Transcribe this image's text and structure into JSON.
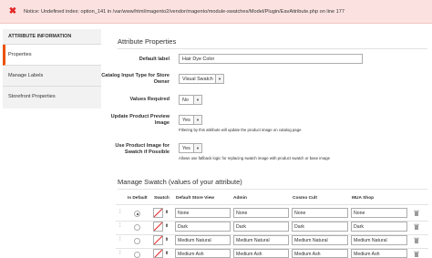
{
  "notice": {
    "text": "Notice: Undefined index: option_141 in /var/www/html/magento2/vendor/magento/module-swatches/Model/Plugin/EavAttribute.php on line 177"
  },
  "sidebar": {
    "title": "ATTRIBUTE INFORMATION",
    "items": [
      {
        "label": "Properties"
      },
      {
        "label": "Manage Labels"
      },
      {
        "label": "Storefront Properties"
      }
    ]
  },
  "properties": {
    "title": "Attribute Properties",
    "default_label": {
      "label": "Default label",
      "value": "Hair Dye Color"
    },
    "catalog_input": {
      "label": "Catalog Input Type for Store Owner",
      "value": "Visual Swatch"
    },
    "values_required": {
      "label": "Values Required",
      "value": "No"
    },
    "update_preview": {
      "label": "Update Product Preview Image",
      "value": "Yes",
      "note": "Filtering by this attribute will update the product image on catalog page"
    },
    "use_fallback": {
      "label": "Use Product Image for Swatch if Possible",
      "value": "Yes",
      "note": "Allows use fallback logic for replacing swatch image with product swatch or base image"
    }
  },
  "swatch": {
    "title": "Manage Swatch (values of your attribute)",
    "columns": [
      "Is Default",
      "Swatch",
      "Default Store View",
      "Admin",
      "Cosmo Cult",
      "MUA Shop"
    ],
    "rows": [
      {
        "is_default": true,
        "values": [
          "None",
          "None",
          "None",
          "None"
        ]
      },
      {
        "is_default": false,
        "values": [
          "Dark",
          "Dark",
          "Dark",
          "Dark"
        ]
      },
      {
        "is_default": false,
        "values": [
          "Medium Natural",
          "Medium Natural",
          "Medium Natural",
          "Medium Natural"
        ]
      },
      {
        "is_default": false,
        "values": [
          "Medium Ash",
          "Medium Ash",
          "Medium Ash",
          "Medium Ash"
        ]
      }
    ]
  },
  "colors": {
    "accent": "#eb5202",
    "error": "#e22626",
    "notice_bg": "#fbe2e0"
  }
}
